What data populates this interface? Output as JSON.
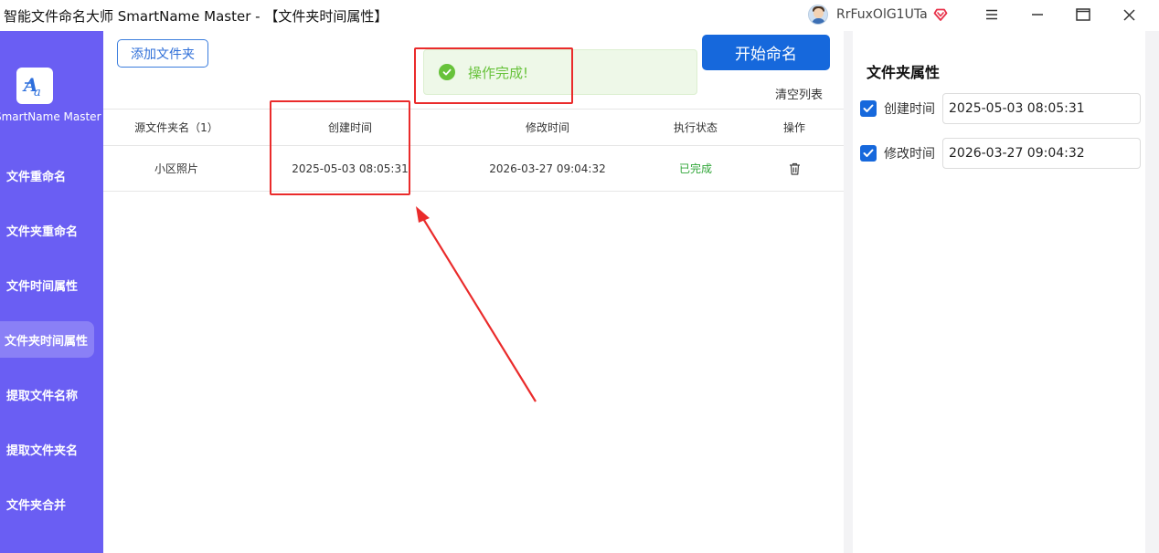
{
  "app": {
    "title": "智能文件命名大师 SmartName Master - 【文件夹时间属性】",
    "username": "RrFuxOlG1UTa",
    "logo_name": "SmartName Master"
  },
  "sidebar": {
    "items": [
      {
        "label": "文件重命名"
      },
      {
        "label": "文件夹重命名"
      },
      {
        "label": "文件时间属性"
      },
      {
        "label": "文件夹时间属性",
        "active": true
      },
      {
        "label": "提取文件名称"
      },
      {
        "label": "提取文件夹名"
      },
      {
        "label": "文件夹合并"
      }
    ]
  },
  "toolbar": {
    "add_folder_label": "添加文件夹",
    "start_label": "开始命名",
    "clear_label": "清空列表"
  },
  "toast": {
    "message": "操作完成!"
  },
  "table": {
    "headers": [
      "源文件夹名（1）",
      "创建时间",
      "修改时间",
      "执行状态",
      "操作"
    ],
    "rows": [
      {
        "name": "小区照片",
        "created": "2025-05-03 08:05:31",
        "modified": "2026-03-27 09:04:32",
        "status": "已完成"
      }
    ]
  },
  "panel": {
    "title": "文件夹属性",
    "create_label": "创建时间",
    "create_value": "2025-05-03 08:05:31",
    "create_checked": true,
    "modify_label": "修改时间",
    "modify_value": "2026-03-27 09:04:32",
    "modify_checked": true
  },
  "colors": {
    "sidebar": "#6a5ef3",
    "primary": "#1668dc",
    "success": "#67c23a",
    "annotation": "#ea2b2b"
  }
}
